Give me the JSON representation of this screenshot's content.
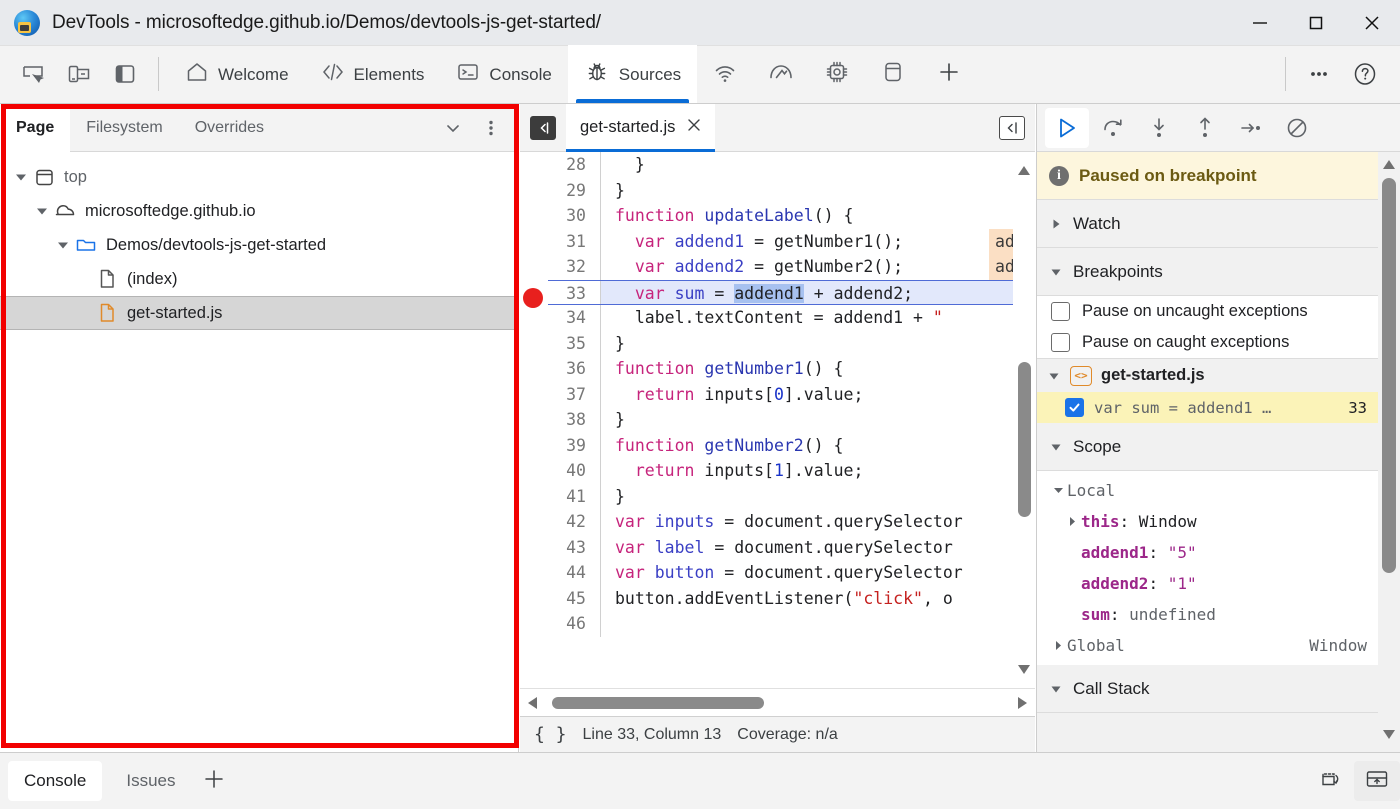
{
  "window": {
    "title": "DevTools - microsoftedge.github.io/Demos/devtools-js-get-started/",
    "logo_icon": "edge-logo-icon",
    "minimize_icon": "minimize-icon",
    "maximize_icon": "maximize-icon",
    "close_icon": "close-icon"
  },
  "toolbar": {
    "left_icons": [
      {
        "name": "inspect-element-icon",
        "label": "Inspect"
      },
      {
        "name": "device-emulation-icon",
        "label": "Toggle device emulation"
      },
      {
        "name": "dock-side-icon",
        "label": "Dock side"
      }
    ],
    "tabs": [
      {
        "label": "Welcome",
        "icon": "home-icon",
        "selected": false
      },
      {
        "label": "Elements",
        "icon": "code-brackets-icon",
        "selected": false
      },
      {
        "label": "Console",
        "icon": "console-prompt-icon",
        "selected": false
      },
      {
        "label": "Sources",
        "icon": "bug-icon",
        "selected": true
      }
    ],
    "icon_tabs": [
      {
        "name": "network-icon",
        "label": "Network"
      },
      {
        "name": "performance-gauge-icon",
        "label": "Performance"
      },
      {
        "name": "memory-chip-icon",
        "label": "Memory"
      },
      {
        "name": "application-storage-icon",
        "label": "Application"
      },
      {
        "name": "add-tab-icon",
        "label": "More tools"
      }
    ],
    "right_icons": [
      {
        "name": "more-options-icon",
        "label": "Customize and control DevTools"
      },
      {
        "name": "help-icon",
        "label": "Help"
      }
    ]
  },
  "navigator": {
    "tabs": [
      {
        "label": "Page",
        "selected": true
      },
      {
        "label": "Filesystem",
        "selected": false
      },
      {
        "label": "Overrides",
        "selected": false
      }
    ],
    "more_tabs_icon": "chevron-down-icon",
    "more_options_icon": "more-vertical-icon",
    "tree": [
      {
        "label": "top",
        "icon": "frame-icon",
        "depth": 0,
        "expanded": true,
        "selected": false
      },
      {
        "label": "microsoftedge.github.io",
        "icon": "cloud-icon",
        "depth": 1,
        "expanded": true,
        "selected": false
      },
      {
        "label": "Demos/devtools-js-get-started",
        "icon": "folder-icon",
        "depth": 2,
        "expanded": true,
        "selected": false
      },
      {
        "label": "(index)",
        "icon": "document-icon",
        "depth": 3,
        "expanded": null,
        "selected": false
      },
      {
        "label": "get-started.js",
        "icon": "js-file-icon",
        "depth": 3,
        "expanded": null,
        "selected": true
      }
    ]
  },
  "editor": {
    "back_button_icon": "panel-collapse-icon",
    "jump_button_icon": "jump-to-previous-icon",
    "file_tab": {
      "label": "get-started.js",
      "close_icon": "close-icon"
    },
    "breakpoint_line": 33,
    "lines": [
      {
        "n": 28,
        "tokens": [
          {
            "t": "  }",
            "c": ""
          }
        ]
      },
      {
        "n": 29,
        "tokens": [
          {
            "t": "}",
            "c": ""
          }
        ]
      },
      {
        "n": 30,
        "tokens": [
          {
            "t": "function ",
            "c": "kw"
          },
          {
            "t": "updateLabel",
            "c": "fn"
          },
          {
            "t": "() {",
            "c": ""
          }
        ]
      },
      {
        "n": 31,
        "tokens": [
          {
            "t": "  ",
            "c": ""
          },
          {
            "t": "var ",
            "c": "kw"
          },
          {
            "t": "addend1",
            "c": "vr"
          },
          {
            "t": " = getNumber1();",
            "c": ""
          }
        ],
        "hint": "add"
      },
      {
        "n": 32,
        "tokens": [
          {
            "t": "  ",
            "c": ""
          },
          {
            "t": "var ",
            "c": "kw"
          },
          {
            "t": "addend2",
            "c": "vr"
          },
          {
            "t": " = getNumber2();",
            "c": ""
          }
        ],
        "hint": "add"
      },
      {
        "n": 33,
        "exec": true,
        "tokens": [
          {
            "t": "  ",
            "c": ""
          },
          {
            "t": "var ",
            "c": "kw"
          },
          {
            "t": "sum",
            "c": "vr"
          },
          {
            "t": " = ",
            "c": ""
          },
          {
            "t": "addend1",
            "c": "sel-tok"
          },
          {
            "t": " + addend2;",
            "c": ""
          }
        ]
      },
      {
        "n": 34,
        "tokens": [
          {
            "t": "  label.textContent = addend1 + ",
            "c": ""
          },
          {
            "t": "\" ",
            "c": "str"
          }
        ]
      },
      {
        "n": 35,
        "tokens": [
          {
            "t": "}",
            "c": ""
          }
        ]
      },
      {
        "n": 36,
        "tokens": [
          {
            "t": "function ",
            "c": "kw"
          },
          {
            "t": "getNumber1",
            "c": "fn"
          },
          {
            "t": "() {",
            "c": ""
          }
        ]
      },
      {
        "n": 37,
        "tokens": [
          {
            "t": "  ",
            "c": ""
          },
          {
            "t": "return ",
            "c": "kw"
          },
          {
            "t": "inputs[",
            "c": ""
          },
          {
            "t": "0",
            "c": "num"
          },
          {
            "t": "].value;",
            "c": ""
          }
        ]
      },
      {
        "n": 38,
        "tokens": [
          {
            "t": "}",
            "c": ""
          }
        ]
      },
      {
        "n": 39,
        "tokens": [
          {
            "t": "function ",
            "c": "kw"
          },
          {
            "t": "getNumber2",
            "c": "fn"
          },
          {
            "t": "() {",
            "c": ""
          }
        ]
      },
      {
        "n": 40,
        "tokens": [
          {
            "t": "  ",
            "c": ""
          },
          {
            "t": "return ",
            "c": "kw"
          },
          {
            "t": "inputs[",
            "c": ""
          },
          {
            "t": "1",
            "c": "num"
          },
          {
            "t": "].value;",
            "c": ""
          }
        ]
      },
      {
        "n": 41,
        "tokens": [
          {
            "t": "}",
            "c": ""
          }
        ]
      },
      {
        "n": 42,
        "tokens": [
          {
            "t": "var ",
            "c": "kw"
          },
          {
            "t": "inputs",
            "c": "vr"
          },
          {
            "t": " = document.querySelector",
            "c": ""
          }
        ]
      },
      {
        "n": 43,
        "tokens": [
          {
            "t": "var ",
            "c": "kw"
          },
          {
            "t": "label",
            "c": "vr"
          },
          {
            "t": " = document.querySelector",
            "c": ""
          }
        ]
      },
      {
        "n": 44,
        "tokens": [
          {
            "t": "var ",
            "c": "kw"
          },
          {
            "t": "button",
            "c": "vr"
          },
          {
            "t": " = document.querySelector",
            "c": ""
          }
        ]
      },
      {
        "n": 45,
        "tokens": [
          {
            "t": "button.addEventListener(",
            "c": ""
          },
          {
            "t": "\"click\"",
            "c": "str"
          },
          {
            "t": ", o",
            "c": ""
          }
        ]
      },
      {
        "n": 46,
        "tokens": [
          {
            "t": "",
            "c": ""
          }
        ]
      }
    ],
    "status": {
      "format_icon": "pretty-print-icon",
      "cursor": "Line 33, Column 13",
      "coverage": "Coverage: n/a"
    }
  },
  "debugger": {
    "controls": [
      {
        "name": "resume-script-button",
        "label": "Resume script execution",
        "icon": "play-icon",
        "active": true
      },
      {
        "name": "step-over-button",
        "label": "Step over next function call",
        "icon": "step-over-icon",
        "active": false
      },
      {
        "name": "step-into-button",
        "label": "Step into next function call",
        "icon": "step-into-icon",
        "active": false
      },
      {
        "name": "step-out-button",
        "label": "Step out of current function",
        "icon": "step-out-icon",
        "active": false
      },
      {
        "name": "step-button",
        "label": "Step",
        "icon": "step-icon",
        "active": false
      },
      {
        "name": "deactivate-breakpoints-button",
        "label": "Deactivate breakpoints",
        "icon": "no-breakpoints-icon",
        "active": false
      }
    ],
    "paused_banner": {
      "icon": "info-icon",
      "text": "Paused on breakpoint"
    },
    "sections": {
      "watch": {
        "label": "Watch",
        "expanded": false
      },
      "breakpoints": {
        "label": "Breakpoints",
        "expanded": true
      },
      "scope": {
        "label": "Scope",
        "expanded": true
      },
      "call_stack": {
        "label": "Call Stack",
        "expanded": true
      }
    },
    "pause_options": [
      {
        "label": "Pause on uncaught exceptions",
        "checked": false
      },
      {
        "label": "Pause on caught exceptions",
        "checked": false
      }
    ],
    "breakpoint_group": {
      "file": "get-started.js",
      "file_icon": "js-source-icon",
      "expanded": true,
      "items": [
        {
          "checked": true,
          "code": "var sum = addend1 …",
          "line": "33"
        }
      ]
    },
    "scope": {
      "groups": [
        {
          "name": "Local",
          "expanded": true,
          "entries": [
            {
              "prop": "this",
              "sep": ": ",
              "value": "Window",
              "expandable": true,
              "value_class": "propn",
              "prop_class": "prop"
            },
            {
              "prop": "addend1",
              "sep": ": ",
              "value": "\"5\"",
              "expandable": false,
              "value_class": "val-str",
              "prop_class": "prop"
            },
            {
              "prop": "addend2",
              "sep": ": ",
              "value": "\"1\"",
              "expandable": false,
              "value_class": "val-str",
              "prop_class": "prop"
            },
            {
              "prop": "sum",
              "sep": ": ",
              "value": "undefined",
              "expandable": false,
              "value_class": "val-undef",
              "prop_class": "prop"
            }
          ]
        },
        {
          "name": "Global",
          "expanded": false,
          "right_value": "Window",
          "entries": []
        }
      ]
    }
  },
  "drawer": {
    "tabs": [
      {
        "label": "Console",
        "selected": true
      },
      {
        "label": "Issues",
        "selected": false
      }
    ],
    "add_icon": "add-tab-icon",
    "right_icons": [
      {
        "name": "restore-drawer-icon",
        "label": "Restore drawer"
      },
      {
        "name": "close-drawer-icon",
        "label": "Close drawer"
      }
    ]
  },
  "annotation": {
    "color": "#f20000",
    "name": "navigator-pane-highlight"
  }
}
